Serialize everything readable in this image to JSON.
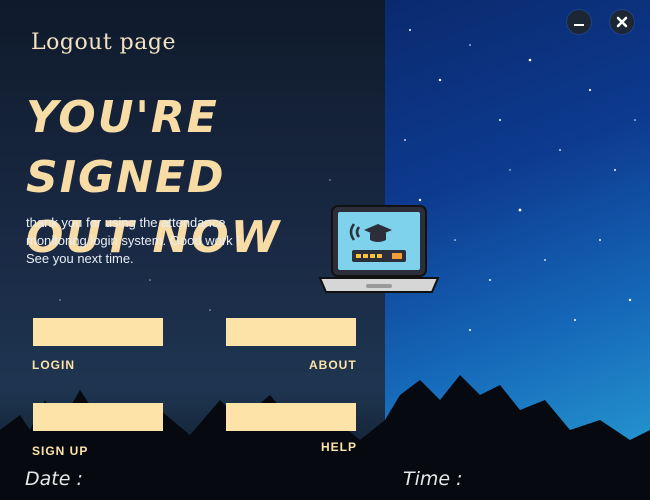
{
  "window": {
    "minimize_icon": "minimize-icon",
    "close_icon": "close-icon"
  },
  "page": {
    "title": "Logout page",
    "headline_line1": "YOU'RE SIGNED",
    "headline_line2": "OUT NOW",
    "message_line1": "thank you for using the attendance",
    "message_line2": "monitoring login system. Good work !",
    "message_line3": "See you next time.",
    "illustration": "laptop-graduation-icon"
  },
  "nav": {
    "login_label": "LOGIN",
    "about_label": "ABOUT",
    "signup_label": "SIGN UP",
    "help_label": "HELP"
  },
  "footer": {
    "date_label": "Date :",
    "time_label": "Time :"
  },
  "colors": {
    "accent": "#fde3a7",
    "headline": "#f8dca6",
    "left_panel": "#1a2a45",
    "right_panel": "#1567b8"
  }
}
